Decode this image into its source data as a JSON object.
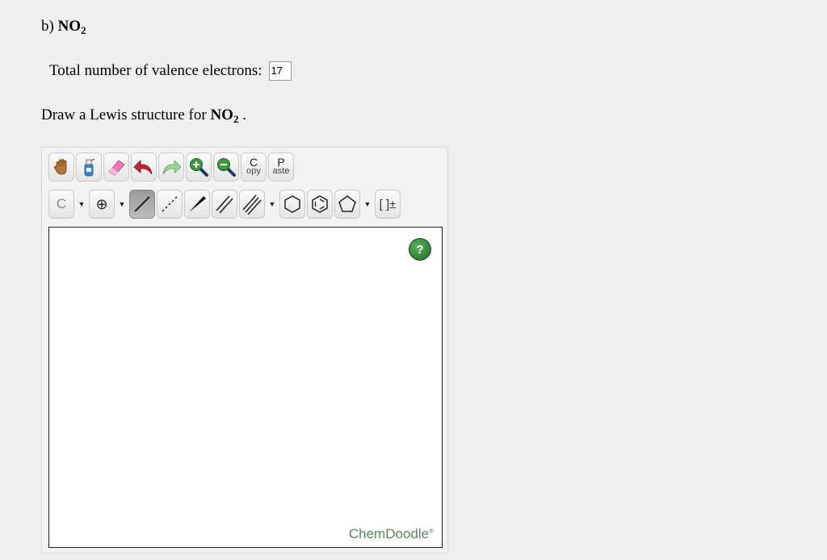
{
  "heading": {
    "prefix": "b)",
    "formula_main": "NO",
    "formula_sub": "2"
  },
  "valence": {
    "label": "Total number of valence electrons:",
    "value": "17"
  },
  "prompt": {
    "text": "Draw a Lewis structure for",
    "formula_main": "NO",
    "formula_sub": "2",
    "suffix": "."
  },
  "editor": {
    "toolbar_row1": {
      "icons": [
        "hand-icon",
        "clear-icon",
        "eraser-icon",
        "undo-icon",
        "redo-icon",
        "zoom-in-icon",
        "zoom-out-icon"
      ],
      "copy": {
        "big": "C",
        "small": "opy"
      },
      "paste": {
        "big": "P",
        "small": "aste"
      }
    },
    "toolbar_row2": {
      "atom_label": "C",
      "charge_label": "⊕",
      "bracket_label": "[ ]±"
    },
    "help_label": "?",
    "brand": "ChemDoodle",
    "brand_mark": "®"
  }
}
